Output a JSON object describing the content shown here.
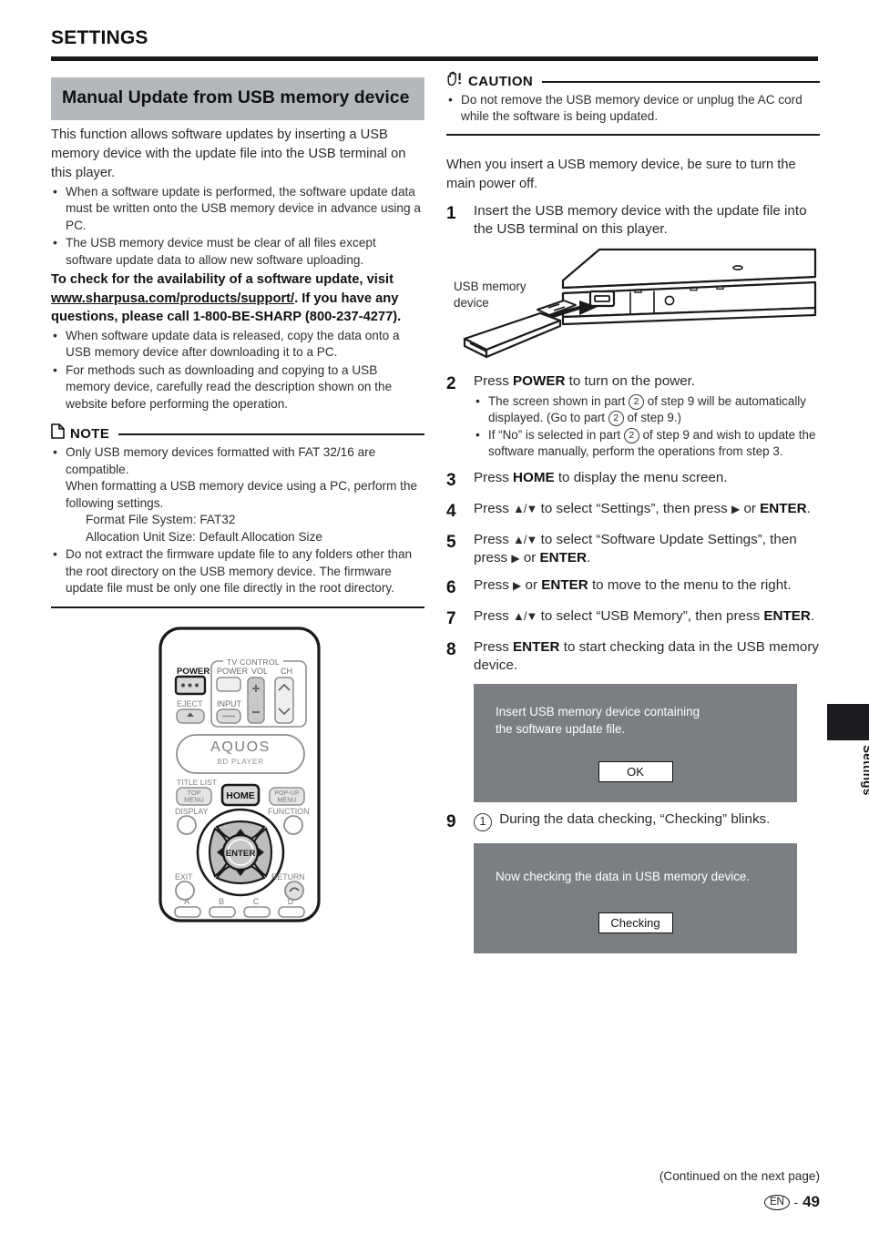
{
  "header": {
    "title": "SETTINGS"
  },
  "section": {
    "banner_title": "Manual Update from USB memory device",
    "intro": "This function allows software updates by inserting a USB memory device with the update file into the USB terminal on this player.",
    "intro_bullets": [
      "When a software update is performed, the software update data must be written onto the USB memory device in advance using a PC.",
      "The USB memory device must be clear of all files except software update data to allow new software uploading."
    ],
    "availability_prefix": "To check for the availability of a software update, visit ",
    "availability_url": "www.sharpusa.com/products/support/",
    "availability_suffix": ". If you have any questions, please call 1-800-BE-SHARP (800-237-4277).",
    "availability_bullets": [
      "When software update data is released, copy the data onto a USB memory device after downloading it to a PC.",
      "For methods such as downloading and copying to a USB memory device, carefully read the description shown on the website before performing the operation."
    ]
  },
  "note": {
    "label": "NOTE",
    "icon": "note-page-icon",
    "bullets": [
      {
        "text": "Only USB memory devices formatted with FAT 32/16 are compatible.",
        "continuation": "When formatting a USB memory device using a PC, perform the following settings.",
        "sub": [
          "Format File System: FAT32",
          "Allocation Unit Size: Default Allocation Size"
        ]
      },
      {
        "text": "Do not extract the firmware update file to any folders other than the root directory on the USB memory device. The firmware update file must be only one file directly in the root directory."
      }
    ]
  },
  "caution": {
    "label": "CAUTION",
    "icon": "hand-warning-icon",
    "bullets": [
      "Do not remove the USB memory device or unplug the AC cord while the software is being updated."
    ]
  },
  "procedure": {
    "lead": "When you insert a USB memory device, be sure to turn the main power off.",
    "steps": [
      {
        "num": "1",
        "text": "Insert the USB memory device with the update file into the USB terminal on this player."
      },
      {
        "num": "2",
        "text_html": "Press <b>POWER</b> to turn on the power.",
        "bullets_html": [
          "The screen shown in part <span class=\"circ\">2</span> of step 9 will be automatically displayed. (Go to part <span class=\"circ\">2</span> of step 9.)",
          "If “No” is selected in part <span class=\"circ\">2</span> of step 9 and wish to update the software manually, perform the operations from step 3."
        ]
      },
      {
        "num": "3",
        "text_html": "Press <b>HOME</b> to display the menu screen."
      },
      {
        "num": "4",
        "text_html": "Press <span class=\"arrow-ud\">▲/▼</span> to select “Settings”, then press <span class=\"arrow-r\">▶</span> or <b>ENTER</b>."
      },
      {
        "num": "5",
        "text_html": "Press <span class=\"arrow-ud\">▲/▼</span> to select “Software Update Settings”, then press <span class=\"arrow-r\">▶</span> or <b>ENTER</b>."
      },
      {
        "num": "6",
        "text_html": "Press <span class=\"arrow-r\">▶</span> or <b>ENTER</b> to move to the menu to the right."
      },
      {
        "num": "7",
        "text_html": "Press <span class=\"arrow-ud\">▲/▼</span> to select “USB Memory”, then press <b>ENTER</b>."
      },
      {
        "num": "8",
        "text_html": "Press <b>ENTER</b> to start checking data in the USB memory device."
      },
      {
        "num": "9",
        "text_html": "<span class=\"circ circ-lg\">1</span> During the data checking, “Checking” blinks."
      }
    ]
  },
  "osd_screens": [
    {
      "name": "insert-usb-screen",
      "lines": [
        "Insert USB memory device containing",
        "the software update file."
      ],
      "button": "OK"
    },
    {
      "name": "checking-screen",
      "lines": [
        "Now checking the data in USB memory device."
      ],
      "button": "Checking"
    }
  ],
  "figure_usb": {
    "label_line1": "USB memory",
    "label_line2": "device"
  },
  "remote": {
    "labels": {
      "power": "POWER",
      "eject": "EJECT",
      "tv_control": "TV CONTROL",
      "tv_power": "POWER",
      "vol": "VOL",
      "ch": "CH",
      "input": "INPUT",
      "brand": "AQUOS",
      "brand_sub": "BD  PLAYER",
      "title_list": "TITLE LIST",
      "top_menu_1": "TOP",
      "top_menu_2": "MENU",
      "home": "HOME",
      "popup_1": "POP-UP",
      "popup_2": "MENU",
      "display": "DISPLAY",
      "function": "FUNCTION",
      "enter": "ENTER",
      "exit": "EXIT",
      "return": "RETURN",
      "color_a": "A",
      "color_b": "B",
      "color_c": "C",
      "color_d": "D"
    }
  },
  "side_tab": {
    "label": "Settings"
  },
  "footer": {
    "continued": "(Continued on the next page)",
    "lang": "EN",
    "sep": "-",
    "page_number": "49"
  },
  "colors": {
    "banner_gray": "#b4b8bd",
    "osd_gray": "#7b7f83",
    "rule_black": "#1a1a1a",
    "tab_black": "#1c1c20"
  }
}
